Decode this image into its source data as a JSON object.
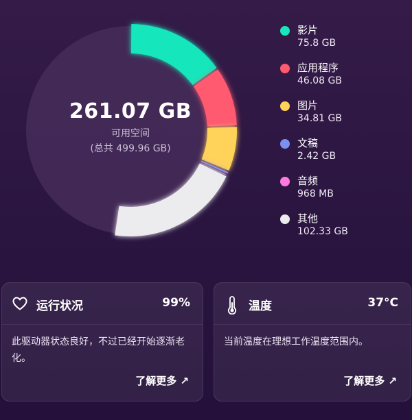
{
  "storage": {
    "free_value": "261.07 GB",
    "free_label": "可用空间",
    "total_label": "(总共 499.96 GB)"
  },
  "chart_data": {
    "type": "pie",
    "categories": [
      "影片",
      "应用程序",
      "图片",
      "文稿",
      "音频",
      "其他"
    ],
    "values": [
      75.8,
      46.08,
      34.81,
      2.42,
      0.968,
      102.33
    ],
    "total": 499.96,
    "free": 261.07,
    "colors": [
      "#19e6bb",
      "#ff5a70",
      "#ffd25a",
      "#7b8ff2",
      "#ff7ae0",
      "#ececef"
    ]
  },
  "legend": [
    {
      "name": "影片",
      "size": "75.8 GB",
      "color": "#19e6bb"
    },
    {
      "name": "应用程序",
      "size": "46.08 GB",
      "color": "#ff5a70"
    },
    {
      "name": "图片",
      "size": "34.81 GB",
      "color": "#ffd25a"
    },
    {
      "name": "文稿",
      "size": "2.42 GB",
      "color": "#7b8ff2"
    },
    {
      "name": "音频",
      "size": "968 MB",
      "color": "#ff7ae0"
    },
    {
      "name": "其他",
      "size": "102.33 GB",
      "color": "#ececef"
    }
  ],
  "health": {
    "icon": "heart-icon",
    "title": "运行状况",
    "value": "99%",
    "description": "此驱动器状态良好，不过已经开始逐渐老化。",
    "link": "了解更多 ↗"
  },
  "temperature": {
    "icon": "thermometer-icon",
    "title": "温度",
    "value": "37°C",
    "description": "当前温度在理想工作温度范围内。",
    "link": "了解更多 ↗"
  }
}
